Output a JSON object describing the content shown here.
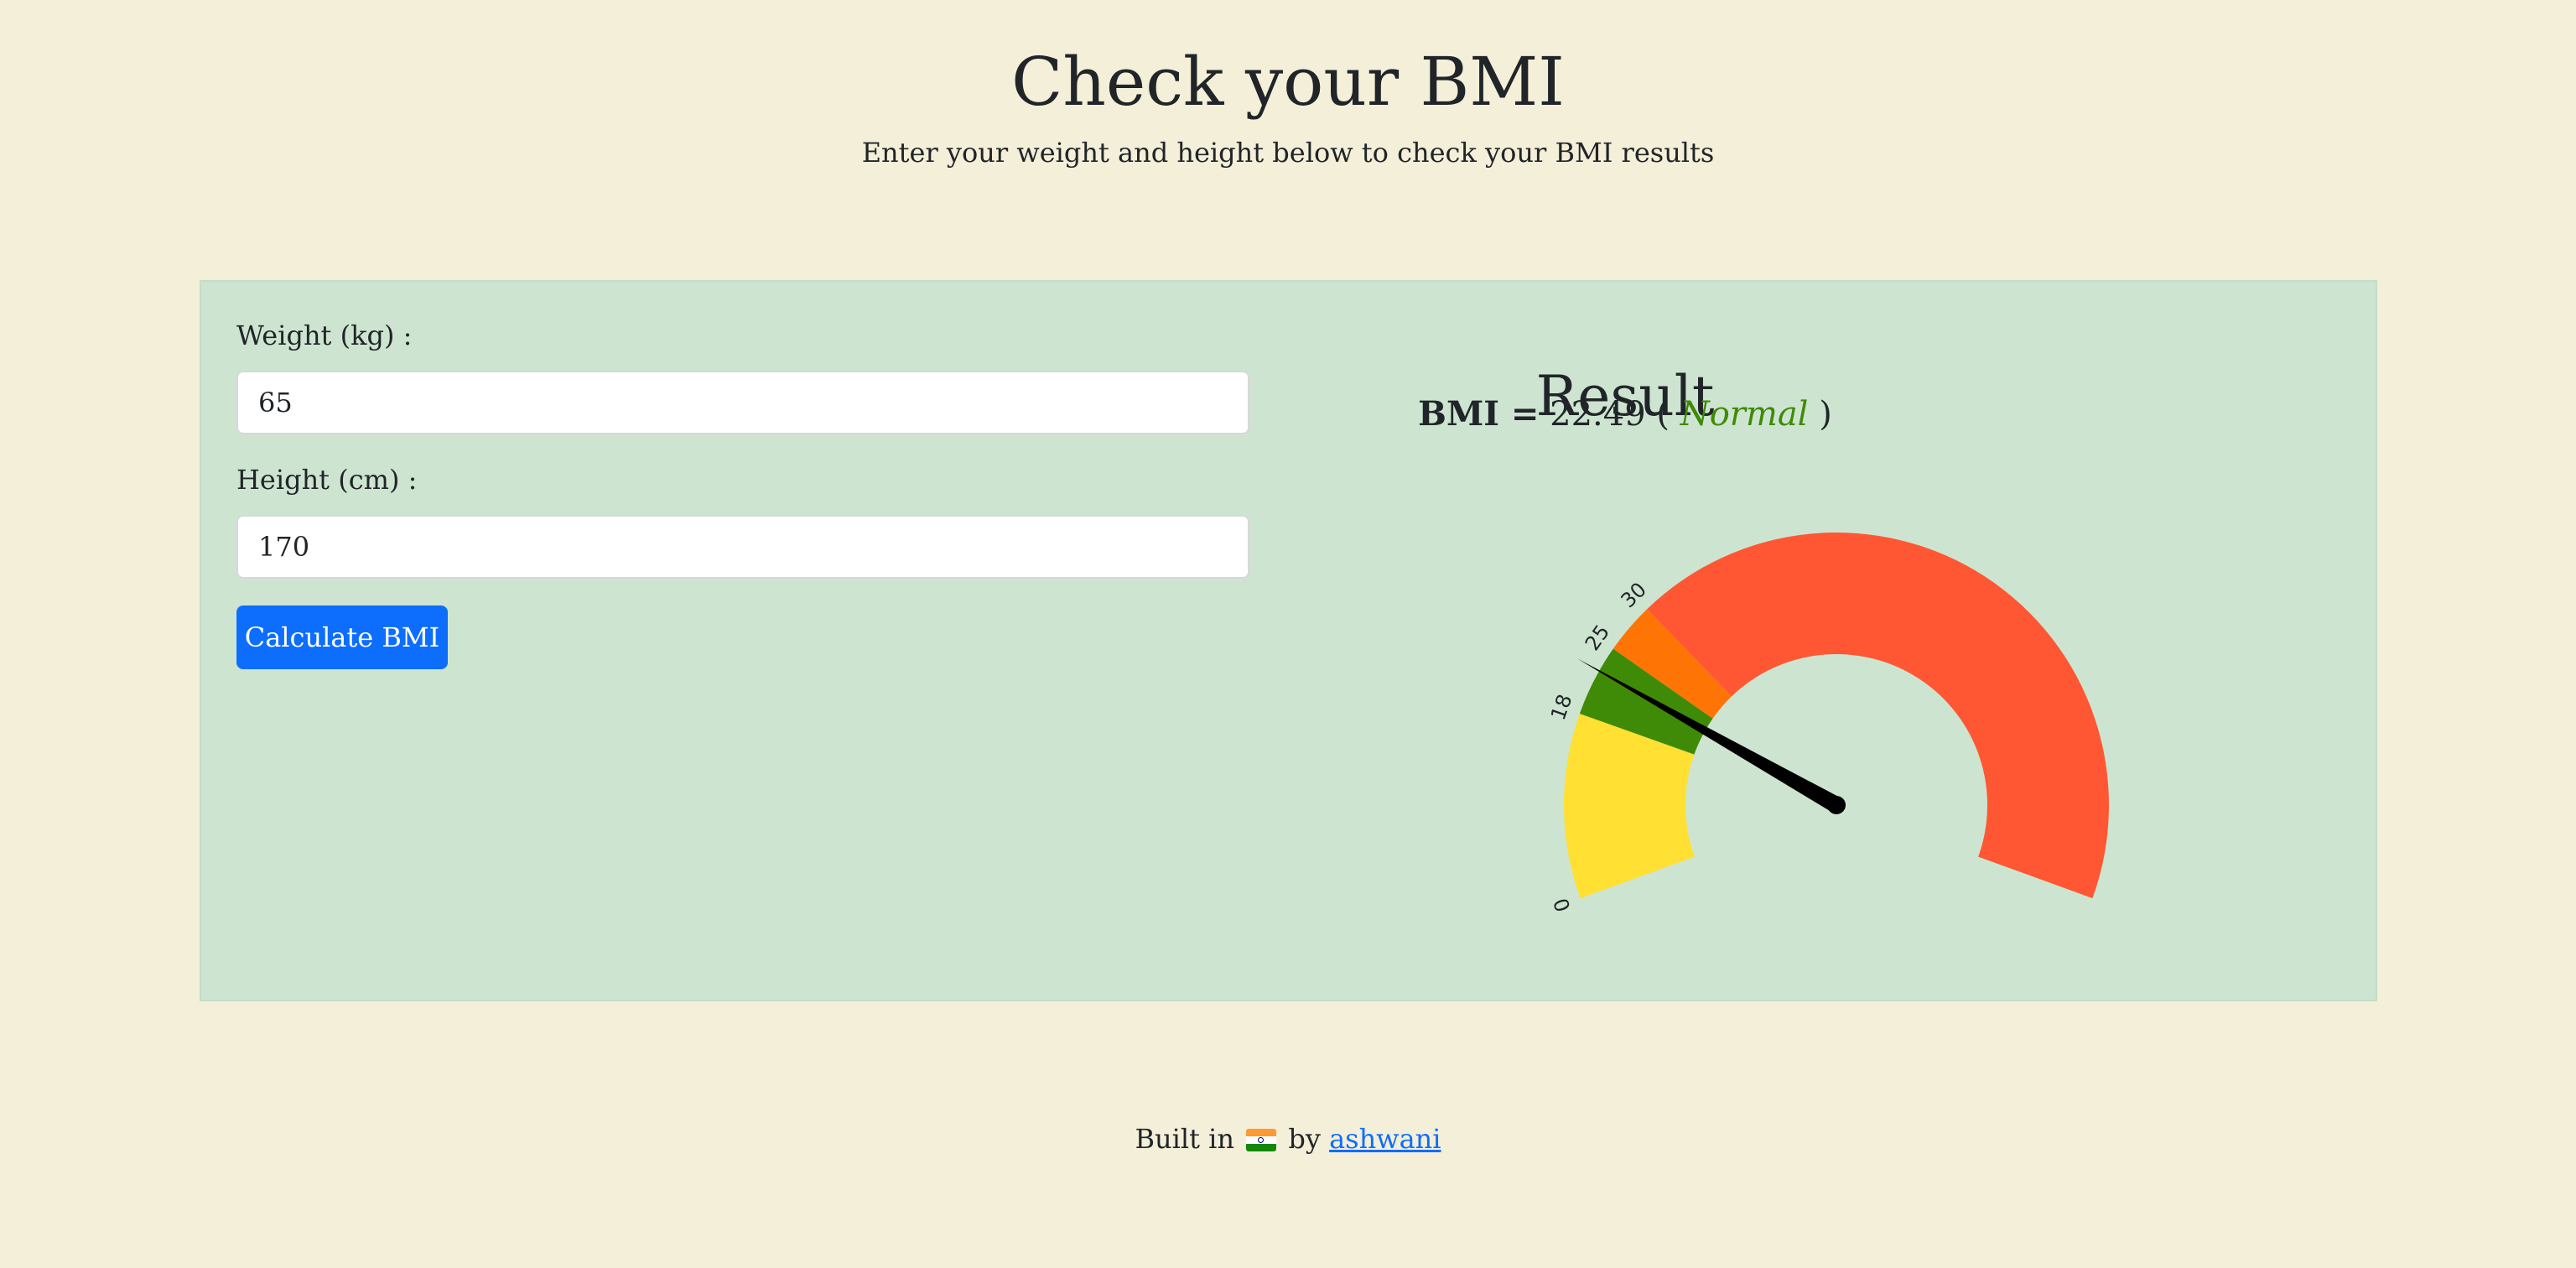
{
  "header": {
    "title": "Check your BMI",
    "subtitle": "Enter your weight and height below to check your BMI results"
  },
  "form": {
    "weight_label": "Weight (kg) :",
    "weight_value": "65",
    "height_label": "Height (cm) :",
    "height_value": "170",
    "submit_label": "Calculate BMI"
  },
  "result": {
    "title": "Result",
    "bmi_label": "BMI =",
    "bmi_value": "22.49",
    "open_paren": "(",
    "category": "Normal",
    "close_paren": ")",
    "category_color": "#3f8a06"
  },
  "gauge": {
    "value": 22.49,
    "max": 100,
    "ticks": [
      "0",
      "18",
      "25",
      "30"
    ],
    "segments": [
      {
        "from": 0,
        "to": 18,
        "color": "#ffe033"
      },
      {
        "from": 18,
        "to": 25,
        "color": "#3f8a06"
      },
      {
        "from": 25,
        "to": 30,
        "color": "#ff7505"
      },
      {
        "from": 30,
        "to": 100,
        "color": "#ff5733"
      }
    ],
    "needle_color": "#000000"
  },
  "footer": {
    "prefix": "Built in",
    "flag_icon": "india-flag-icon",
    "by": "by",
    "author": "ashwani"
  },
  "colors": {
    "background": "#f4efd8",
    "card": "#cde5d0",
    "button": "#0d6efd"
  }
}
